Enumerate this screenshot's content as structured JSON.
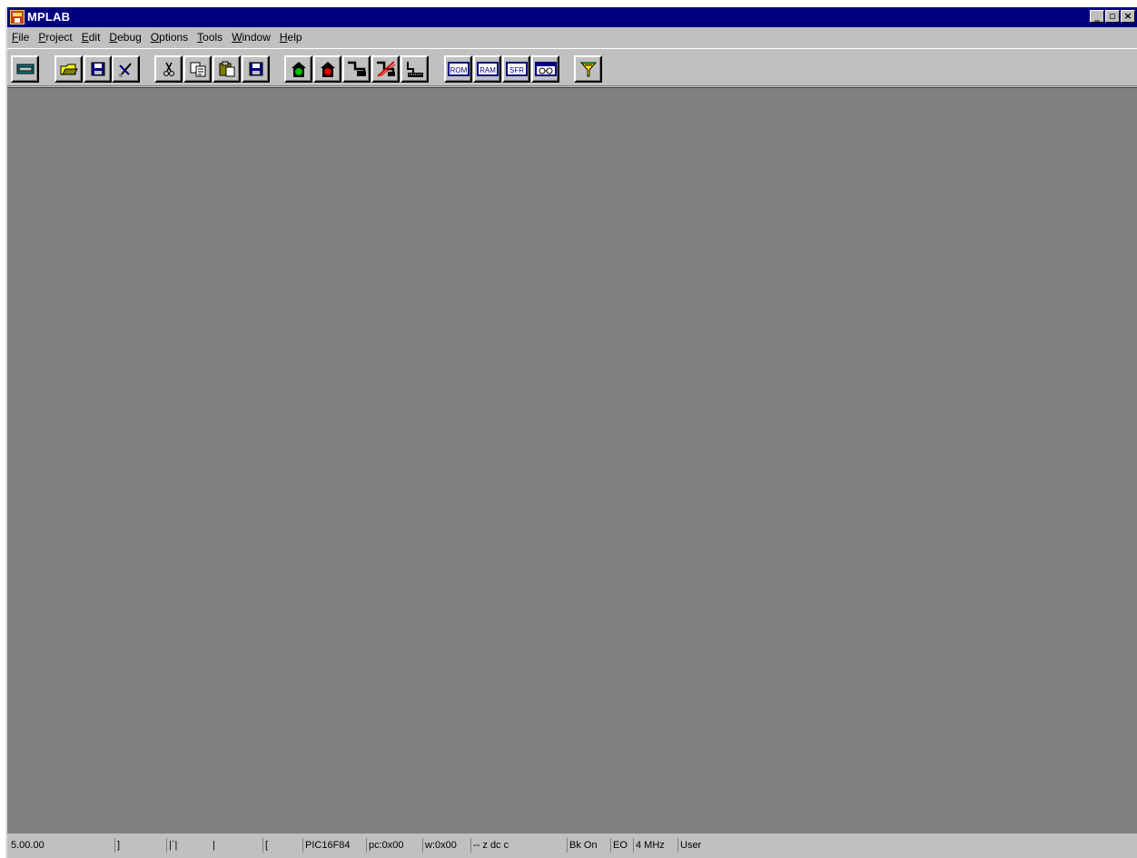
{
  "window": {
    "title": "MPLAB",
    "controls": [
      "minimize-icon",
      "restore-icon",
      "close-icon"
    ],
    "colors": {
      "titlebar": "#00007f",
      "chrome": "#c0c0c0",
      "workspace": "#808080"
    }
  },
  "menubar": {
    "items": [
      {
        "accel": "F",
        "rest": "ile"
      },
      {
        "accel": "P",
        "rest": "roject"
      },
      {
        "accel": "E",
        "rest": "dit"
      },
      {
        "accel": "D",
        "rest": "ebug"
      },
      {
        "accel": "O",
        "rest": "ptions"
      },
      {
        "accel": "T",
        "rest": "ools"
      },
      {
        "accel": "W",
        "rest": "indow"
      },
      {
        "accel": "H",
        "rest": "elp"
      }
    ]
  },
  "toolbar": {
    "buttons": [
      {
        "icon": "open-project-icon"
      },
      {
        "icon": "open-file-icon"
      },
      {
        "icon": "save-file-icon"
      },
      {
        "icon": "build-tool-icon"
      },
      {
        "icon": "cut-icon"
      },
      {
        "icon": "copy-icon"
      },
      {
        "icon": "paste-icon"
      },
      {
        "icon": "save-icon"
      },
      {
        "icon": "run-go-icon"
      },
      {
        "icon": "halt-stop-icon"
      },
      {
        "icon": "step-into-icon"
      },
      {
        "icon": "step-over-icon"
      },
      {
        "icon": "reset-icon"
      },
      {
        "icon": "rom-window-icon",
        "label": "ROM"
      },
      {
        "icon": "ram-window-icon",
        "label": "RAM"
      },
      {
        "icon": "sfr-window-icon",
        "label": "SFR"
      },
      {
        "icon": "watch-window-icon"
      },
      {
        "icon": "trace-filter-icon"
      }
    ]
  },
  "statusbar": {
    "fields": [
      "5.00.00",
      "]",
      "|`|",
      "|",
      "[",
      "PIC16F84",
      "pc:0x00",
      "w:0x00",
      "-- z dc c",
      "Bk On",
      "EO",
      "4 MHz",
      "User"
    ]
  }
}
